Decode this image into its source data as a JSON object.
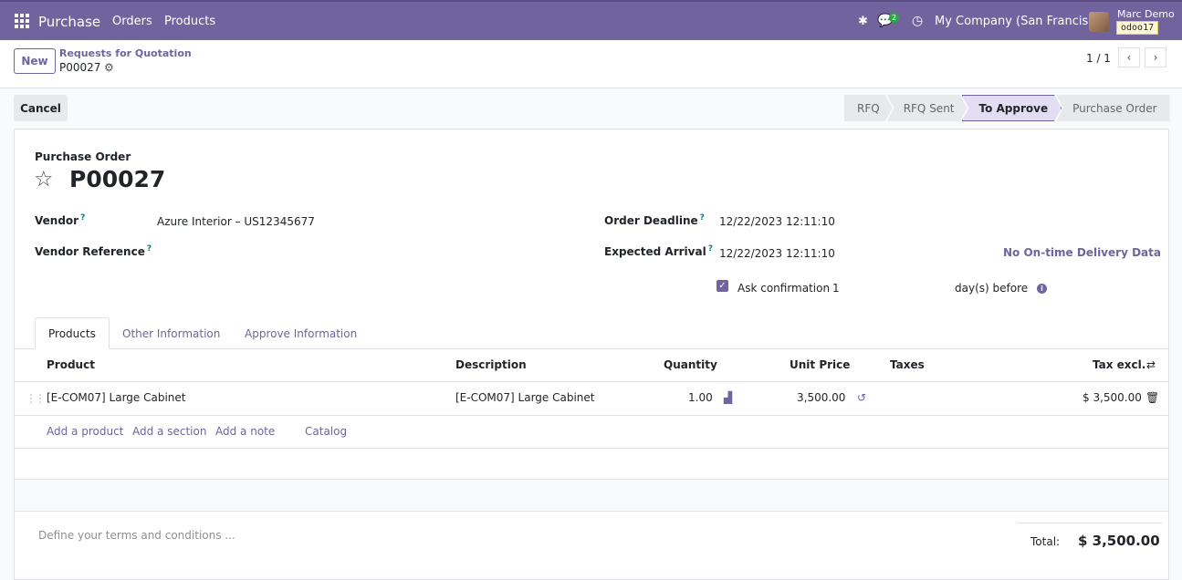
{
  "navbar": {
    "app_name": "Purchase",
    "menu": [
      "Orders",
      "Products"
    ],
    "messages_count": "2",
    "company": "My Company (San Francisco)",
    "user_name": "Marc Demo",
    "db_name": "odoo17"
  },
  "control": {
    "new_label": "New",
    "breadcrumb_parent": "Requests for Quotation",
    "breadcrumb_current": "P00027",
    "pager": "1 / 1"
  },
  "actions": {
    "cancel_label": "Cancel",
    "stages": [
      "RFQ",
      "RFQ Sent",
      "To Approve",
      "Purchase Order"
    ],
    "active_stage": "To Approve"
  },
  "form": {
    "doc_type": "Purchase Order",
    "name": "P00027",
    "vendor_label": "Vendor",
    "vendor_value": "Azure Interior – US12345677",
    "vendor_ref_label": "Vendor Reference",
    "deadline_label": "Order Deadline",
    "deadline_value": "12/22/2023 12:11:10",
    "arrival_label": "Expected Arrival",
    "arrival_value": "12/22/2023 12:11:10",
    "ontime_link": "No On-time Delivery Data",
    "ask_confirmation_label": "Ask confirmation",
    "ask_confirmation_days": "1",
    "days_before_label": "day(s) before"
  },
  "tabs": [
    "Products",
    "Other Information",
    "Approve Information"
  ],
  "table": {
    "headers": {
      "product": "Product",
      "description": "Description",
      "quantity": "Quantity",
      "unit_price": "Unit Price",
      "taxes": "Taxes",
      "tax_excl": "Tax excl."
    },
    "rows": [
      {
        "product": "[E-COM07] Large Cabinet",
        "description": "[E-COM07] Large Cabinet",
        "quantity": "1.00",
        "unit_price": "3,500.00",
        "taxes": "",
        "subtotal": "$ 3,500.00"
      }
    ],
    "add_links": [
      "Add a product",
      "Add a section",
      "Add a note",
      "Catalog"
    ]
  },
  "footer": {
    "terms_placeholder": "Define your terms and conditions ...",
    "total_label": "Total:",
    "total_value": "$ 3,500.00"
  }
}
